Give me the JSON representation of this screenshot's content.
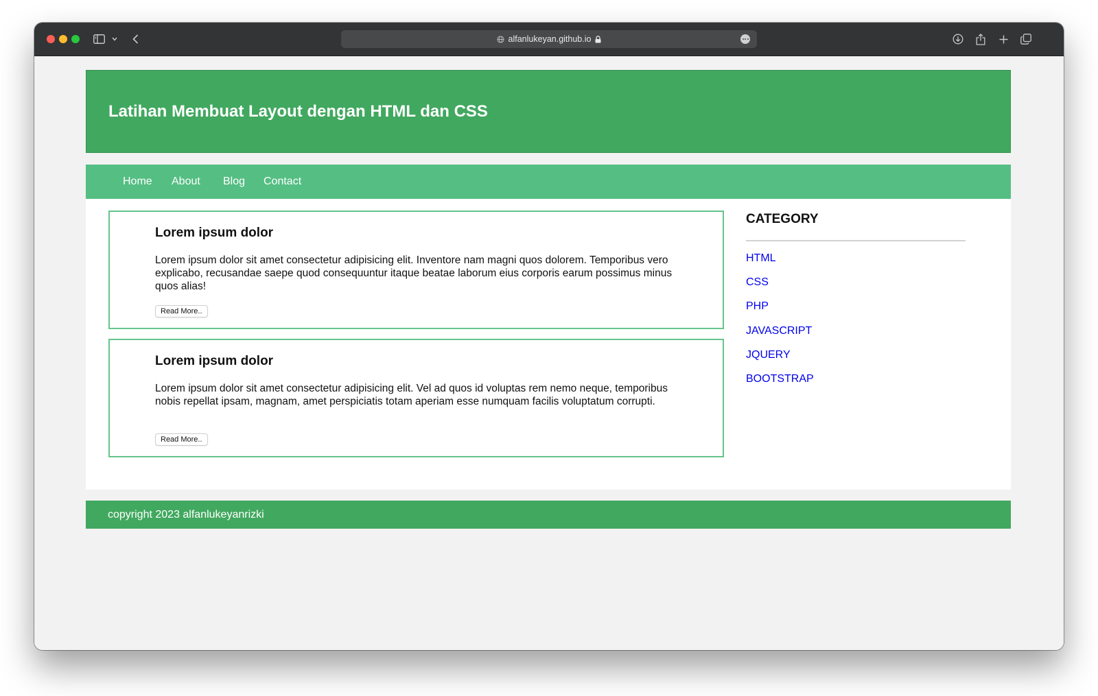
{
  "browser": {
    "url": "alfanlukeyan.github.io",
    "icons": {
      "sidebar": "sidebar-icon",
      "sidebar_menu": "chevron-down-icon",
      "back": "chevron-left-icon",
      "download": "download-icon",
      "share": "share-icon",
      "new_tab": "plus-icon",
      "tabs": "tab-overview-icon",
      "site": "globe-icon",
      "secure": "lock-icon",
      "more": "more-icon"
    }
  },
  "page": {
    "header": {
      "title": "Latihan Membuat Layout dengan HTML dan CSS"
    },
    "nav": {
      "items": [
        {
          "label": "Home"
        },
        {
          "label": "About"
        },
        {
          "label": "Blog"
        },
        {
          "label": "Contact"
        }
      ]
    },
    "articles": [
      {
        "title": "Lorem ipsum dolor",
        "body": "Lorem ipsum dolor sit amet consectetur adipisicing elit. Inventore nam magni quos dolorem. Temporibus vero explicabo, recusandae saepe quod consequuntur itaque beatae laborum eius corporis earum possimus minus quos alias!",
        "button": "Read More.."
      },
      {
        "title": "Lorem ipsum dolor",
        "body": "Lorem ipsum dolor sit amet consectetur adipisicing elit. Vel ad quos id voluptas rem nemo neque, temporibus nobis repellat ipsam, magnam, amet perspiciatis totam aperiam esse numquam facilis voluptatum corrupti.",
        "button": "Read More.."
      }
    ],
    "sidebar": {
      "title": "CATEGORY",
      "categories": [
        {
          "label": "HTML"
        },
        {
          "label": "CSS"
        },
        {
          "label": "PHP"
        },
        {
          "label": "JAVASCRIPT"
        },
        {
          "label": "JQUERY"
        },
        {
          "label": "BOOTSTRAP"
        }
      ]
    },
    "footer": {
      "text": "copyright 2023 alfanlukeyanrizki"
    }
  },
  "colors": {
    "header": "#41a85f",
    "nav": "#54be83",
    "article_border": "#64c48b",
    "link": "#0000ee",
    "footer": "#41a85f",
    "page_background": "#f2f2f2"
  }
}
